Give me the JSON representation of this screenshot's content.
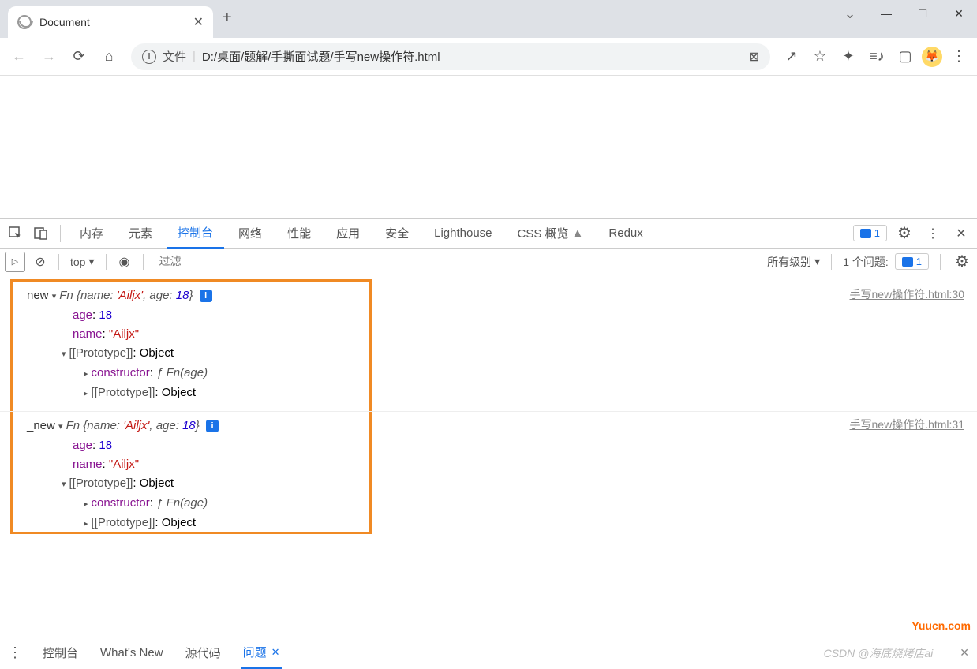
{
  "titlebar": {
    "tab_title": "Document",
    "close": "✕",
    "newtab": "+",
    "chevron": "⌄",
    "minimize": "—",
    "maximize": "☐",
    "close_win": "✕"
  },
  "addrbar": {
    "info_glyph": "i",
    "file_label": "文件",
    "divider": "|",
    "url": "D:/桌面/题解/手撕面试题/手写new操作符.html",
    "translate_glyph": "⊠",
    "share_glyph": "↗",
    "star_glyph": "☆",
    "puzzle_glyph": "✦",
    "music_glyph": "≡♪",
    "reader_glyph": "▢",
    "avatar_glyph": "🦊",
    "menu_glyph": "⋮",
    "back": "←",
    "forward": "→",
    "reload": "⟳",
    "home": "⌂"
  },
  "devtools": {
    "tabs": {
      "memory": "内存",
      "elements": "元素",
      "console": "控制台",
      "network": "网络",
      "performance": "性能",
      "application": "应用",
      "security": "安全",
      "lighthouse": "Lighthouse",
      "css": "CSS 概览",
      "beaker": "▲",
      "redux": "Redux",
      "issues_count": "1",
      "gear": "⚙",
      "more": "⋮",
      "close": "✕"
    },
    "toolbar": {
      "play_glyph": "▷",
      "clear_glyph": "⊘",
      "context": "top",
      "tri": "▾",
      "eye_glyph": "◉",
      "filter_placeholder": "过滤",
      "levels": "所有级别",
      "issues_label": "1 个问题:",
      "issues_count": "1",
      "gear": "⚙"
    }
  },
  "console": {
    "logs": [
      {
        "label": "new",
        "source": "手写new操作符.html:30",
        "summary_cls": "Fn",
        "summary_obj": "{name: 'Ailjx', age: 18}",
        "age_key": "age",
        "age_val": "18",
        "name_key": "name",
        "name_val": "\"Ailjx\"",
        "proto_key": "[[Prototype]]",
        "proto_val": "Object",
        "ctor_key": "constructor",
        "ctor_val": "ƒ Fn(age)",
        "proto2_key": "[[Prototype]]",
        "proto2_val": "Object"
      },
      {
        "label": "_new",
        "source": "手写new操作符.html:31",
        "summary_cls": "Fn",
        "summary_obj": "{name: 'Ailjx', age: 18}",
        "age_key": "age",
        "age_val": "18",
        "name_key": "name",
        "name_val": "\"Ailjx\"",
        "proto_key": "[[Prototype]]",
        "proto_val": "Object",
        "ctor_key": "constructor",
        "ctor_val": "ƒ Fn(age)",
        "proto2_key": "[[Prototype]]",
        "proto2_val": "Object"
      }
    ]
  },
  "drawer": {
    "console": "控制台",
    "whatsnew": "What's New",
    "sources": "源代码",
    "issues": "问题",
    "close": "✕",
    "watermark": "CSDN @海底烧烤店ai",
    "more": "⋮"
  },
  "misc": {
    "yuucn": "Yuucn.com"
  }
}
